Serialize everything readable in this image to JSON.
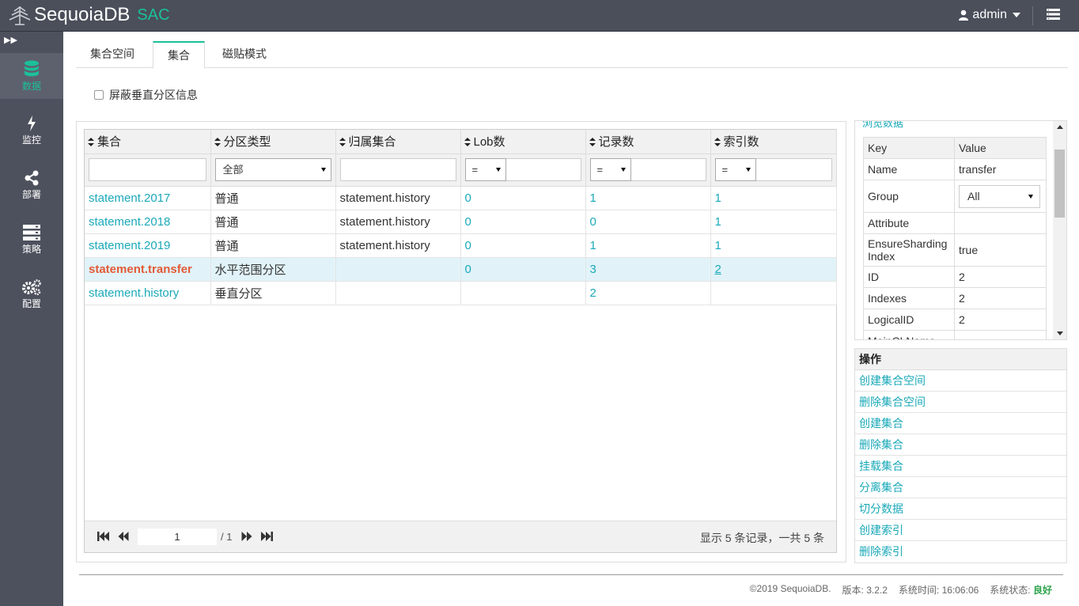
{
  "header": {
    "brand": "SequoiaDB",
    "product": "SAC",
    "user": "admin"
  },
  "sidebar": {
    "items": [
      {
        "label": "数据",
        "icon": "database-icon",
        "active": true
      },
      {
        "label": "监控",
        "icon": "bolt-icon",
        "active": false
      },
      {
        "label": "部署",
        "icon": "share-icon",
        "active": false
      },
      {
        "label": "策略",
        "icon": "server-icon",
        "active": false
      },
      {
        "label": "配置",
        "icon": "cogs-icon",
        "active": false
      }
    ]
  },
  "tabs": [
    {
      "label": "集合空间",
      "active": false
    },
    {
      "label": "集合",
      "active": true
    },
    {
      "label": "磁贴模式",
      "active": false
    }
  ],
  "hide_vertical_label": "屏蔽垂直分区信息",
  "grid": {
    "columns": [
      "集合",
      "分区类型",
      "归属集合",
      "Lob数",
      "记录数",
      "索引数"
    ],
    "filters": {
      "type_select": "全部",
      "op": "="
    },
    "rows": [
      {
        "name": "statement.2017",
        "type": "普通",
        "main": "statement.history",
        "lob": "0",
        "records": "1",
        "indexes": "1"
      },
      {
        "name": "statement.2018",
        "type": "普通",
        "main": "statement.history",
        "lob": "0",
        "records": "0",
        "indexes": "1"
      },
      {
        "name": "statement.2019",
        "type": "普通",
        "main": "statement.history",
        "lob": "0",
        "records": "1",
        "indexes": "1"
      },
      {
        "name": "statement.transfer",
        "type": "水平范围分区",
        "main": "",
        "lob": "0",
        "records": "3",
        "indexes": "2"
      },
      {
        "name": "statement.history",
        "type": "垂直分区",
        "main": "",
        "lob": "",
        "records": "2",
        "indexes": ""
      }
    ],
    "pager": {
      "page": "1",
      "total_pages": "/ 1",
      "info": "显示 5 条记录，一共 5 条"
    }
  },
  "detail": {
    "title": "浏览数据",
    "key_header": "Key",
    "value_header": "Value",
    "rows": [
      {
        "key": "Name",
        "value": "transfer"
      },
      {
        "key": "Group",
        "value": "All"
      },
      {
        "key": "Attribute",
        "value": ""
      },
      {
        "key": "EnsureSharding Index",
        "value": "true"
      },
      {
        "key": "ID",
        "value": "2"
      },
      {
        "key": "Indexes",
        "value": "2"
      },
      {
        "key": "LogicalID",
        "value": "2"
      },
      {
        "key": "MainCLName",
        "value": ""
      }
    ]
  },
  "operations": {
    "title": "操作",
    "items": [
      "创建集合空间",
      "删除集合空间",
      "创建集合",
      "删除集合",
      "挂载集合",
      "分离集合",
      "切分数据",
      "创建索引",
      "删除索引"
    ]
  },
  "footer": {
    "copyright": "©2019 SequoiaDB.",
    "version": "版本: 3.2.2",
    "time": "系统时间: 16:06:06",
    "status_label": "系统状态:",
    "status_value": "良好"
  },
  "colors": {
    "accent": "#1bc09b",
    "link": "#1ba9b8",
    "header_bg": "#4a4f5a",
    "sidebar_bg": "#4d515d",
    "highlight": "#e25a36",
    "selected_row": "#e1f3f9"
  }
}
